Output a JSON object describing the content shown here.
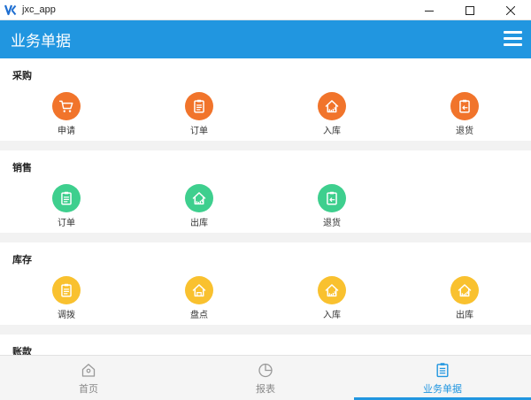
{
  "window": {
    "title": "jxc_app"
  },
  "header": {
    "title": "业务单据"
  },
  "colors": {
    "primary": "#2196e0",
    "purchase": "#f1742b",
    "sales": "#3ecf8e",
    "inventory": "#f9c12f"
  },
  "sections": [
    {
      "title": "采购",
      "items": [
        {
          "label": "申请",
          "icon": "cart-icon"
        },
        {
          "label": "订单",
          "icon": "clipboard-icon"
        },
        {
          "label": "入库",
          "icon": "warehouse-in-icon"
        },
        {
          "label": "退货",
          "icon": "return-clipboard-icon"
        }
      ]
    },
    {
      "title": "销售",
      "items": [
        {
          "label": "订单",
          "icon": "clipboard-icon"
        },
        {
          "label": "出库",
          "icon": "warehouse-out-icon"
        },
        {
          "label": "退货",
          "icon": "return-clipboard-icon"
        }
      ]
    },
    {
      "title": "库存",
      "items": [
        {
          "label": "调拨",
          "icon": "clipboard-icon"
        },
        {
          "label": "盘点",
          "icon": "warehouse-icon"
        },
        {
          "label": "入库",
          "icon": "warehouse-in-icon"
        },
        {
          "label": "出库",
          "icon": "warehouse-out-icon"
        }
      ]
    },
    {
      "title": "账款",
      "items": []
    }
  ],
  "tabs": [
    {
      "label": "首页",
      "icon": "home-icon"
    },
    {
      "label": "报表",
      "icon": "pie-chart-icon"
    },
    {
      "label": "业务单据",
      "icon": "document-icon",
      "active": true
    }
  ]
}
